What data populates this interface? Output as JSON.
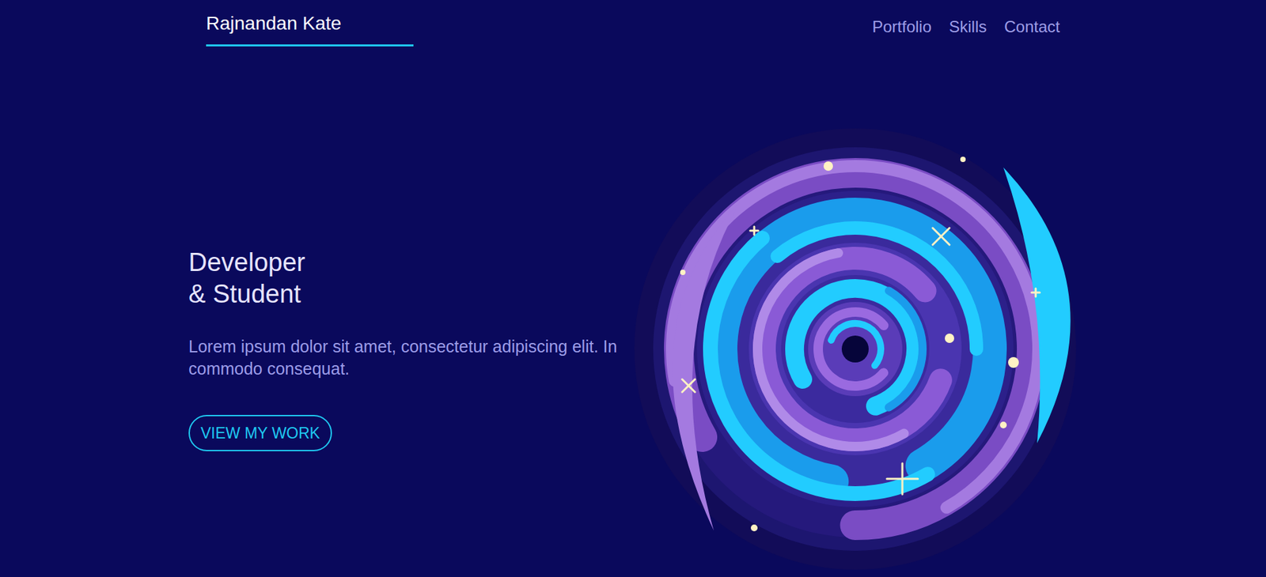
{
  "header": {
    "name": "Rajnandan Kate"
  },
  "nav": [
    {
      "label": "Portfolio"
    },
    {
      "label": "Skills"
    },
    {
      "label": "Contact"
    }
  ],
  "hero": {
    "headline": [
      "Developer",
      "& Student"
    ],
    "text": "Lorem ipsum dolor sit amet, consectetur adipiscing elit. In commodo consequat.",
    "button": "VIEW MY WORK"
  }
}
